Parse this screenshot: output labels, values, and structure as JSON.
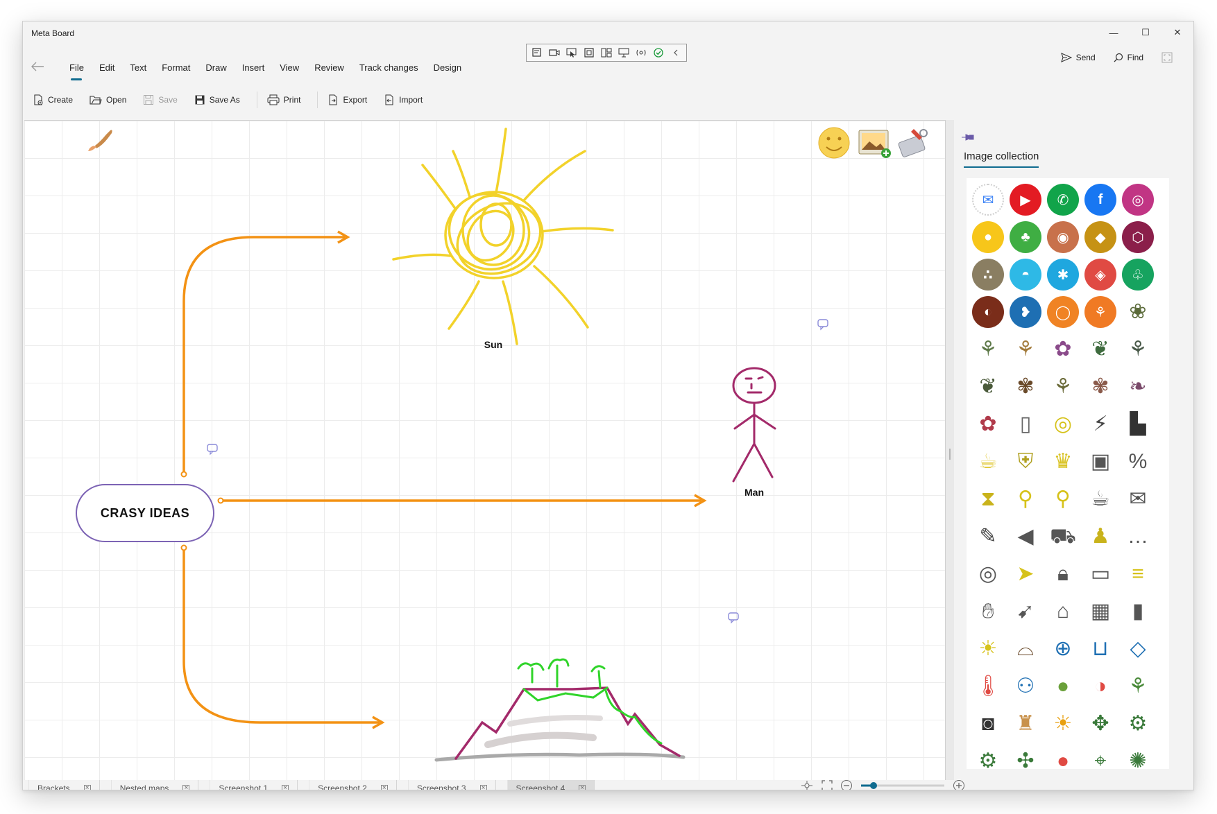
{
  "app": {
    "title": "Meta Board"
  },
  "window_controls": {
    "minimize": "—",
    "maximize": "☐",
    "close": "✕"
  },
  "menu": {
    "items": [
      "File",
      "Edit",
      "Text",
      "Format",
      "Draw",
      "Insert",
      "View",
      "Review",
      "Track changes",
      "Design"
    ],
    "active": "File"
  },
  "quick_access": [
    "slides-icon",
    "video-icon",
    "pointer-icon",
    "frame-icon",
    "layout-icon",
    "present-icon",
    "scan-icon",
    "check-circle-icon",
    "collapse-icon"
  ],
  "actions": {
    "send": "Send",
    "find": "Find"
  },
  "toolbar": {
    "create": "Create",
    "open": "Open",
    "save": "Save",
    "save_as": "Save As",
    "print": "Print",
    "export": "Export",
    "import": "Import"
  },
  "mindmap": {
    "root": "CRASY IDEAS",
    "nodes": [
      {
        "label": "Sun"
      },
      {
        "label": "Man"
      },
      {
        "label": ""
      }
    ]
  },
  "panel": {
    "title": "Image collection"
  },
  "image_collection": [
    {
      "icon": "messenger-icon",
      "bg": "#ffffff",
      "fg": "#3b82f6"
    },
    {
      "icon": "youtube-icon",
      "bg": "#e31b23",
      "fg": "#ffffff"
    },
    {
      "icon": "whatsapp-icon",
      "bg": "#11a44a",
      "fg": "#ffffff"
    },
    {
      "icon": "facebook-icon",
      "bg": "#1877f2",
      "fg": "#ffffff"
    },
    {
      "icon": "instagram-icon",
      "bg": "#c13584",
      "fg": "#ffffff"
    },
    {
      "icon": "bubbles-icon",
      "bg": "#f7c61a",
      "fg": "#ffffff"
    },
    {
      "icon": "celery-icon",
      "bg": "#3fae43",
      "fg": "#ffffff"
    },
    {
      "icon": "peanut-icon",
      "bg": "#c8714b",
      "fg": "#ffffff"
    },
    {
      "icon": "mustard-icon",
      "bg": "#c69214",
      "fg": "#ffffff"
    },
    {
      "icon": "molecule-icon",
      "bg": "#8b1f4a",
      "fg": "#ffffff"
    },
    {
      "icon": "seeds-icon",
      "bg": "#8a7e62",
      "fg": "#ffffff"
    },
    {
      "icon": "shell-icon",
      "bg": "#2eb9e6",
      "fg": "#ffffff"
    },
    {
      "icon": "crab-icon",
      "bg": "#1fa7df",
      "fg": "#ffffff"
    },
    {
      "icon": "nut-icon",
      "bg": "#e04a43",
      "fg": "#ffffff"
    },
    {
      "icon": "soy-icon",
      "bg": "#16a35f",
      "fg": "#ffffff"
    },
    {
      "icon": "milk-icon",
      "bg": "#7a2d1a",
      "fg": "#ffffff"
    },
    {
      "icon": "fish-icon",
      "bg": "#1e6fb3",
      "fg": "#ffffff"
    },
    {
      "icon": "egg-icon",
      "bg": "#f08324",
      "fg": "#ffffff"
    },
    {
      "icon": "wheat-icon",
      "bg": "#f07a24",
      "fg": "#ffffff"
    },
    {
      "icon": "flower-icon",
      "bg": "#ffffff",
      "fg": "#5b6b3a"
    },
    {
      "icon": "plant-icon",
      "bg": "#ffffff",
      "fg": "#5f7a4a"
    },
    {
      "icon": "twig-icon",
      "bg": "#ffffff",
      "fg": "#a27a3a"
    },
    {
      "icon": "bloom-icon",
      "bg": "#ffffff",
      "fg": "#8a4a8a"
    },
    {
      "icon": "leaf-icon",
      "bg": "#ffffff",
      "fg": "#3e6b3e"
    },
    {
      "icon": "fern-icon",
      "bg": "#ffffff",
      "fg": "#4a5a4a"
    },
    {
      "icon": "leaf-icon",
      "bg": "#ffffff",
      "fg": "#4a5a3a"
    },
    {
      "icon": "sprig-icon",
      "bg": "#ffffff",
      "fg": "#6a4a2a"
    },
    {
      "icon": "bud-icon",
      "bg": "#ffffff",
      "fg": "#6b6b3a"
    },
    {
      "icon": "branch-icon",
      "bg": "#ffffff",
      "fg": "#8a5a4a"
    },
    {
      "icon": "vine-icon",
      "bg": "#ffffff",
      "fg": "#7a4a6a"
    },
    {
      "icon": "rose-icon",
      "bg": "#ffffff",
      "fg": "#b03a4a"
    },
    {
      "icon": "phone-icon",
      "bg": "#ffffff",
      "fg": "#666666"
    },
    {
      "icon": "coins-icon",
      "bg": "#ffffff",
      "fg": "#d6c21a"
    },
    {
      "icon": "lightning-icon",
      "bg": "#ffffff",
      "fg": "#444444"
    },
    {
      "icon": "hat-icon",
      "bg": "#ffffff",
      "fg": "#333333"
    },
    {
      "icon": "cup-icon",
      "bg": "#ffffff",
      "fg": "#e0c733"
    },
    {
      "icon": "shield-icon",
      "bg": "#ffffff",
      "fg": "#b0a020"
    },
    {
      "icon": "trophy-icon",
      "bg": "#ffffff",
      "fg": "#d9c324"
    },
    {
      "icon": "wallet-icon",
      "bg": "#ffffff",
      "fg": "#555555"
    },
    {
      "icon": "percent-icon",
      "bg": "#ffffff",
      "fg": "#555555"
    },
    {
      "icon": "hourglass-icon",
      "bg": "#ffffff",
      "fg": "#c9b31c"
    },
    {
      "icon": "pin-icon",
      "bg": "#ffffff",
      "fg": "#d6c21a"
    },
    {
      "icon": "magnifier-icon",
      "bg": "#ffffff",
      "fg": "#d6c21a"
    },
    {
      "icon": "mug-icon",
      "bg": "#ffffff",
      "fg": "#555555"
    },
    {
      "icon": "envelope-icon",
      "bg": "#ffffff",
      "fg": "#555555"
    },
    {
      "icon": "pencil-icon",
      "bg": "#ffffff",
      "fg": "#444444"
    },
    {
      "icon": "megaphone-icon",
      "bg": "#ffffff",
      "fg": "#555555"
    },
    {
      "icon": "cart-icon",
      "bg": "#ffffff",
      "fg": "#555555"
    },
    {
      "icon": "stamp-icon",
      "bg": "#ffffff",
      "fg": "#c9b31c"
    },
    {
      "icon": "chat-icon",
      "bg": "#ffffff",
      "fg": "#555555"
    },
    {
      "icon": "target-icon",
      "bg": "#ffffff",
      "fg": "#555555"
    },
    {
      "icon": "paper-plane-icon",
      "bg": "#ffffff",
      "fg": "#d6c21a"
    },
    {
      "icon": "padlock-icon",
      "bg": "#ffffff",
      "fg": "#555555"
    },
    {
      "icon": "laptop-icon",
      "bg": "#ffffff",
      "fg": "#555555"
    },
    {
      "icon": "coin-stack-icon",
      "bg": "#ffffff",
      "fg": "#d6c21a"
    },
    {
      "icon": "thumbs-up-icon",
      "bg": "#ffffff",
      "fg": "#555555"
    },
    {
      "icon": "rocket-icon",
      "bg": "#ffffff",
      "fg": "#555555"
    },
    {
      "icon": "graduation-cap-icon",
      "bg": "#ffffff",
      "fg": "#555555"
    },
    {
      "icon": "safe-icon",
      "bg": "#ffffff",
      "fg": "#555555"
    },
    {
      "icon": "book-icon",
      "bg": "#ffffff",
      "fg": "#555555"
    },
    {
      "icon": "lightbulb-icon",
      "bg": "#ffffff",
      "fg": "#d6c21a"
    },
    {
      "icon": "sun-hat-icon",
      "bg": "#ffffff",
      "fg": "#6a4a2a"
    },
    {
      "icon": "lifebuoy-icon",
      "bg": "#ffffff",
      "fg": "#1e6fb3"
    },
    {
      "icon": "bucket-icon",
      "bg": "#ffffff",
      "fg": "#1e6fb3"
    },
    {
      "icon": "kite-icon",
      "bg": "#ffffff",
      "fg": "#1e6fb3"
    },
    {
      "icon": "thermometer-icon",
      "bg": "#ffffff",
      "fg": "#e04a43"
    },
    {
      "icon": "sunglasses-icon",
      "bg": "#ffffff",
      "fg": "#1e6fb3"
    },
    {
      "icon": "coconut-icon",
      "bg": "#ffffff",
      "fg": "#6aa03a"
    },
    {
      "icon": "beach-ball-icon",
      "bg": "#ffffff",
      "fg": "#e04a43"
    },
    {
      "icon": "palm-tree-icon",
      "bg": "#ffffff",
      "fg": "#4a8a3a"
    },
    {
      "icon": "camera-icon",
      "bg": "#ffffff",
      "fg": "#333333"
    },
    {
      "icon": "sandcastle-icon",
      "bg": "#ffffff",
      "fg": "#c8914b"
    },
    {
      "icon": "sun-face-icon",
      "bg": "#ffffff",
      "fg": "#e8a010"
    },
    {
      "icon": "drone-icon",
      "bg": "#ffffff",
      "fg": "#3a7a3a"
    },
    {
      "icon": "robot-arm-icon",
      "bg": "#ffffff",
      "fg": "#3a7a3a"
    },
    {
      "icon": "tractor-icon",
      "bg": "#ffffff",
      "fg": "#3a7a3a"
    },
    {
      "icon": "windmill-icon",
      "bg": "#ffffff",
      "fg": "#3a7a3a"
    },
    {
      "icon": "apple-icon",
      "bg": "#ffffff",
      "fg": "#e04a43"
    },
    {
      "icon": "sensor-icon",
      "bg": "#ffffff",
      "fg": "#3a7a3a"
    },
    {
      "icon": "sprinkler-icon",
      "bg": "#ffffff",
      "fg": "#3a7a3a"
    }
  ],
  "zoom": {
    "level": 0.15
  },
  "tabs": [
    {
      "label": "Brackets",
      "active": false
    },
    {
      "label": "Nested maps",
      "active": false
    },
    {
      "label": "Screenshot 1",
      "active": false
    },
    {
      "label": "Screenshot 2",
      "active": false
    },
    {
      "label": "Screenshot 3",
      "active": false
    },
    {
      "label": "Screenshot 4",
      "active": true
    }
  ],
  "colors": {
    "accent": "#0f6b8f",
    "connector": "#f39214",
    "root_border": "#7c63b4"
  }
}
